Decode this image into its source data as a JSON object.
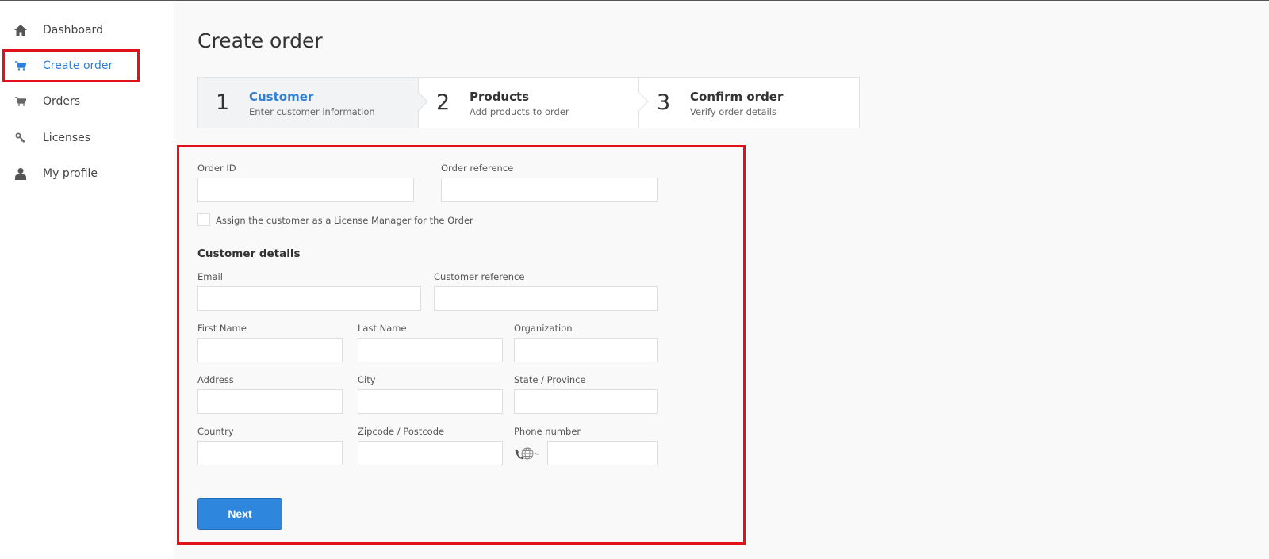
{
  "sidebar": {
    "items": [
      {
        "label": "Dashboard",
        "icon": "home-icon"
      },
      {
        "label": "Create order",
        "icon": "cart-icon",
        "active": true
      },
      {
        "label": "Orders",
        "icon": "cart-icon"
      },
      {
        "label": "Licenses",
        "icon": "key-icon"
      },
      {
        "label": "My profile",
        "icon": "user-icon"
      }
    ]
  },
  "page": {
    "title": "Create order"
  },
  "stepper": {
    "steps": [
      {
        "num": "1",
        "title": "Customer",
        "subtitle": "Enter customer information",
        "active": true
      },
      {
        "num": "2",
        "title": "Products",
        "subtitle": "Add products to order"
      },
      {
        "num": "3",
        "title": "Confirm order",
        "subtitle": "Verify order details"
      }
    ]
  },
  "form": {
    "order_id": {
      "label": "Order ID",
      "value": ""
    },
    "order_reference": {
      "label": "Order reference",
      "value": ""
    },
    "license_manager_checkbox": {
      "label": "Assign the customer as a License Manager for the Order",
      "checked": false
    },
    "section_title": "Customer details",
    "email": {
      "label": "Email",
      "value": ""
    },
    "customer_reference": {
      "label": "Customer reference",
      "value": ""
    },
    "first_name": {
      "label": "First Name",
      "value": ""
    },
    "last_name": {
      "label": "Last Name",
      "value": ""
    },
    "organization": {
      "label": "Organization",
      "value": ""
    },
    "address": {
      "label": "Address",
      "value": ""
    },
    "city": {
      "label": "City",
      "value": ""
    },
    "state": {
      "label": "State / Province",
      "value": ""
    },
    "country": {
      "label": "Country",
      "value": ""
    },
    "zipcode": {
      "label": "Zipcode / Postcode",
      "value": ""
    },
    "phone": {
      "label": "Phone number",
      "value": "",
      "country_icon": "globe-icon"
    },
    "next_label": "Next"
  },
  "colors": {
    "accent": "#2f87dd",
    "active_text": "#2f7fd8",
    "highlight": "#e0111a"
  }
}
